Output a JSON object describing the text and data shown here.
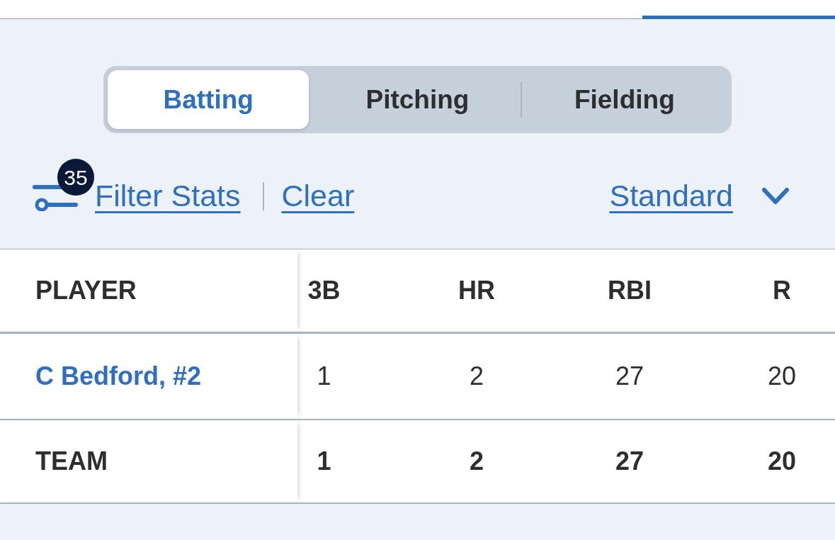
{
  "segments": [
    {
      "label": "Batting",
      "selected": true
    },
    {
      "label": "Pitching",
      "selected": false
    },
    {
      "label": "Fielding",
      "selected": false
    }
  ],
  "filter": {
    "badge": "35",
    "label": "Filter Stats",
    "clear": "Clear",
    "view": "Standard"
  },
  "table": {
    "columns": [
      "PLAYER",
      "3B",
      "HR",
      "RBI",
      "R"
    ],
    "rows": [
      {
        "kind": "player",
        "cells": [
          "C Bedford, #2",
          "1",
          "2",
          "27",
          "20"
        ]
      },
      {
        "kind": "total",
        "cells": [
          "TEAM",
          "1",
          "2",
          "27",
          "20"
        ]
      }
    ]
  }
}
